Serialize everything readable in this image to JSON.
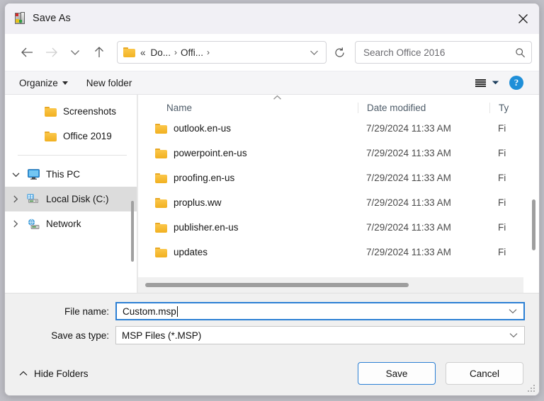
{
  "window": {
    "title": "Save As",
    "icon": "installer-icon",
    "close_label": "Close"
  },
  "nav": {
    "back": "Back",
    "forward": "Forward",
    "recent": "Recent locations",
    "up": "Up one level",
    "refresh": "Refresh",
    "address": {
      "folder_icon": "folder-icon",
      "prefix": "«",
      "crumbs": [
        "Do...",
        "Offi..."
      ],
      "separator": "›"
    },
    "search": {
      "placeholder": "Search Office 2016",
      "icon": "search-icon"
    }
  },
  "command_bar": {
    "organize": "Organize",
    "new_folder": "New folder",
    "view_icon": "list-view-icon",
    "view_dropdown_icon": "chevron-down-icon",
    "help_label": "?"
  },
  "sidebar": {
    "items": [
      {
        "label": "Screenshots",
        "icon": "folder-icon",
        "indent": 1,
        "expander": "",
        "selected": false
      },
      {
        "label": "Office 2019",
        "icon": "folder-icon",
        "indent": 1,
        "expander": "",
        "selected": false
      },
      {
        "separator": true
      },
      {
        "label": "This PC",
        "icon": "monitor-icon",
        "indent": 0,
        "expander": "chevron-down-icon",
        "selected": false
      },
      {
        "label": "Local Disk (C:)",
        "icon": "drive-icon",
        "indent": 1,
        "expander": "chevron-right-icon",
        "selected": true
      },
      {
        "label": "Network",
        "icon": "network-icon",
        "indent": 0,
        "expander": "chevron-right-icon",
        "selected": false
      }
    ]
  },
  "file_list": {
    "sort_indicator": "ⱏ",
    "columns": [
      "Name",
      "Date modified",
      "Ty"
    ],
    "rows": [
      {
        "name": "outlook.en-us",
        "date": "7/29/2024 11:33 AM",
        "type": "Fi"
      },
      {
        "name": "powerpoint.en-us",
        "date": "7/29/2024 11:33 AM",
        "type": "Fi"
      },
      {
        "name": "proofing.en-us",
        "date": "7/29/2024 11:33 AM",
        "type": "Fi"
      },
      {
        "name": "proplus.ww",
        "date": "7/29/2024 11:33 AM",
        "type": "Fi"
      },
      {
        "name": "publisher.en-us",
        "date": "7/29/2024 11:33 AM",
        "type": "Fi"
      },
      {
        "name": "updates",
        "date": "7/29/2024 11:33 AM",
        "type": "Fi"
      }
    ]
  },
  "form": {
    "file_name_label": "File name:",
    "file_name_value": "Custom.msp",
    "save_as_type_label": "Save as type:",
    "save_as_type_value": "MSP Files (*.MSP)"
  },
  "footer": {
    "hide_folders": "Hide Folders",
    "hide_folders_icon": "chevron-up-icon",
    "save": "Save",
    "cancel": "Cancel"
  },
  "colors": {
    "accent": "#2b7fd4",
    "titlebar_bg": "#f1f0f5",
    "panel_bg": "#f0f0f0",
    "selection_bg": "#dcdcdc",
    "folder_yellow": "#f3b429",
    "help_blue": "#1f8fd8"
  }
}
